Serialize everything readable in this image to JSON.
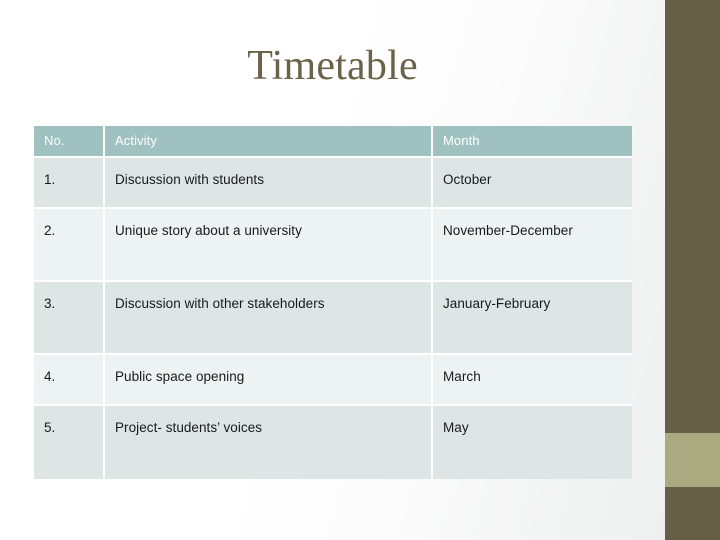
{
  "slide": {
    "title": "Timetable",
    "accent_dark": "#665e47",
    "accent_light": "#aaaa80",
    "header_fill": "#9fc1c0",
    "row_fill_odd": "#dde5e5",
    "row_fill_even": "#edf3f2",
    "title_color": "#6b6349"
  },
  "table": {
    "headers": {
      "no": "No.",
      "activity": "Activity",
      "month": "Month"
    },
    "rows": [
      {
        "no": "1.",
        "activity": "Discussion with students",
        "month": "October"
      },
      {
        "no": "2.",
        "activity": "Unique story about a university",
        "month": "November-December"
      },
      {
        "no": "3.",
        "activity": "Discussion with other stakeholders",
        "month": "January-February"
      },
      {
        "no": "4.",
        "activity": "Public space opening",
        "month": "March"
      },
      {
        "no": "5.",
        "activity": "Project- students’ voices",
        "month": "May"
      }
    ]
  }
}
